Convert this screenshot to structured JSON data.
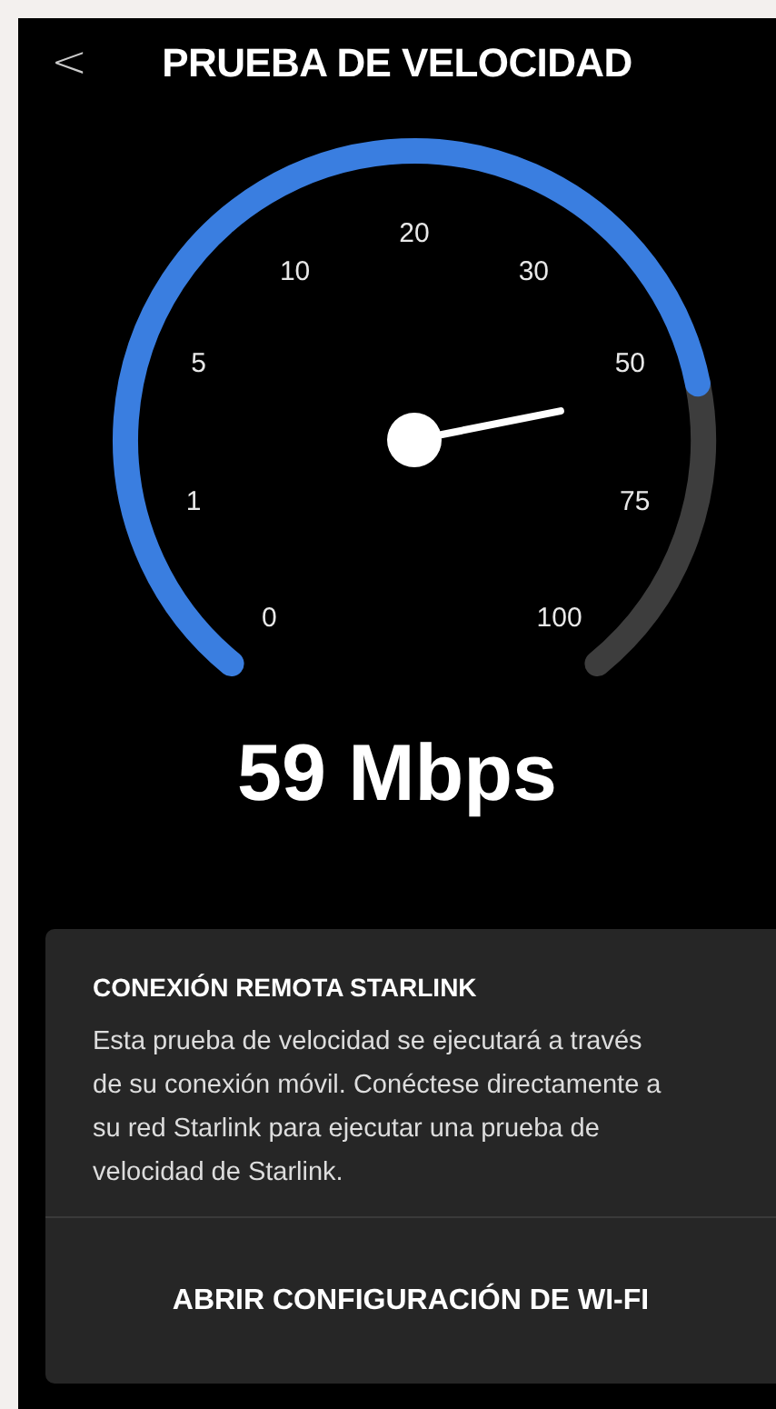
{
  "header": {
    "back_icon": "<",
    "title": "PRUEBA DE VELOCIDAD"
  },
  "gauge": {
    "tick_labels": [
      "0",
      "1",
      "5",
      "10",
      "20",
      "30",
      "50",
      "75",
      "100"
    ]
  },
  "speed": "59 Mbps",
  "notice": {
    "title": "CONEXIÓN REMOTA STARLINK",
    "body": "Esta prueba de velocidad se ejecutará a través de su conexión móvil. Conéctese directamente a su red Starlink para ejecutar una prueba de velocidad de Starlink.",
    "button": "ABRIR CONFIGURACIÓN DE WI-FI"
  }
}
